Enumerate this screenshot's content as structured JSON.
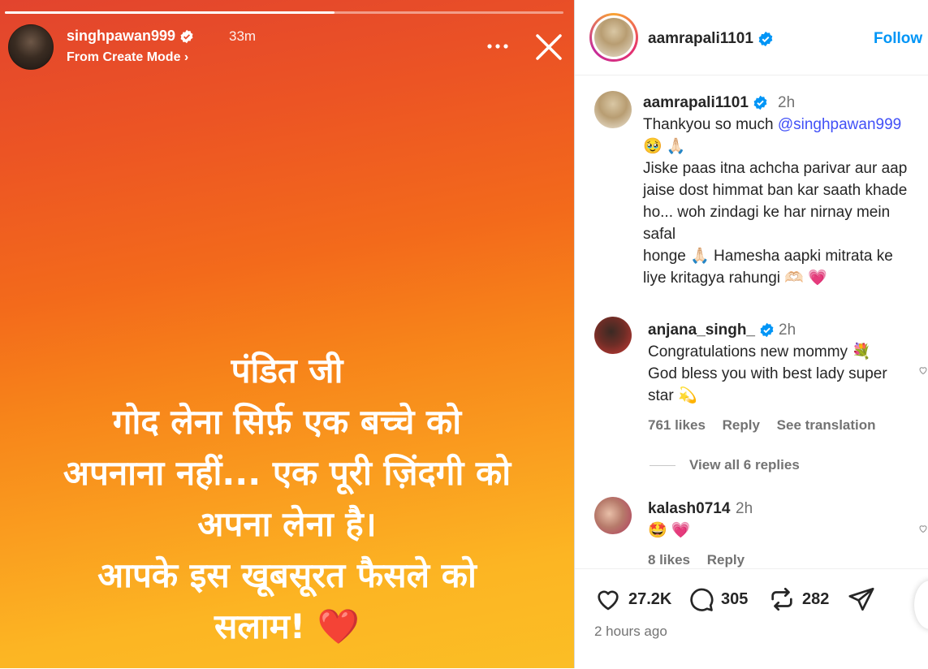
{
  "story": {
    "progress": 0.59,
    "username": "singhpawan999",
    "time": "33m",
    "subtitle": "From Create Mode ›",
    "lines": [
      "पंडित जी",
      "गोद लेना सिर्फ़ एक बच्चे को",
      "अपनाना नहीं... एक पूरी ज़िंदगी को",
      "अपना लेना है।",
      "आपके इस खूबसूरत फैसले को",
      "सलाम! ❤️"
    ]
  },
  "post": {
    "username": "aamrapali1101",
    "follow_label": "Follow"
  },
  "comments": [
    {
      "user": "aamrapali1101",
      "time": "2h",
      "lines": [
        "Thankyou so much ",
        "🥹 🙏🏻",
        "Jiske paas itna achcha parivar aur aap",
        "jaise dost himmat ban kar saath khade",
        "ho... woh zindagi ke har nirnay mein",
        "safal",
        "honge 🙏🏻 Hamesha aapki mitrata ke",
        "liye kritagya rahungi 🫶🏻 💗"
      ],
      "mention": "@singhpawan999"
    },
    {
      "user": "anjana_singh_",
      "time": "2h",
      "lines": [
        "Congratulations new mommy 💐",
        "God bless you with best lady super",
        "star 💫"
      ],
      "likes": "761 likes",
      "reply": "Reply",
      "translation": "See translation",
      "view_replies": "View all 6 replies"
    },
    {
      "user": "kalash0714",
      "time": "2h",
      "lines": [
        "🤩 💗"
      ],
      "likes": "8 likes",
      "reply": "Reply"
    }
  ],
  "actions": {
    "likes": "27.2K",
    "comments": "305",
    "reposts": "282",
    "time_ago": "2 hours ago"
  },
  "colors": {
    "accent": "#0095f6",
    "mention": "#4150f7",
    "verified": "#0095f6"
  }
}
